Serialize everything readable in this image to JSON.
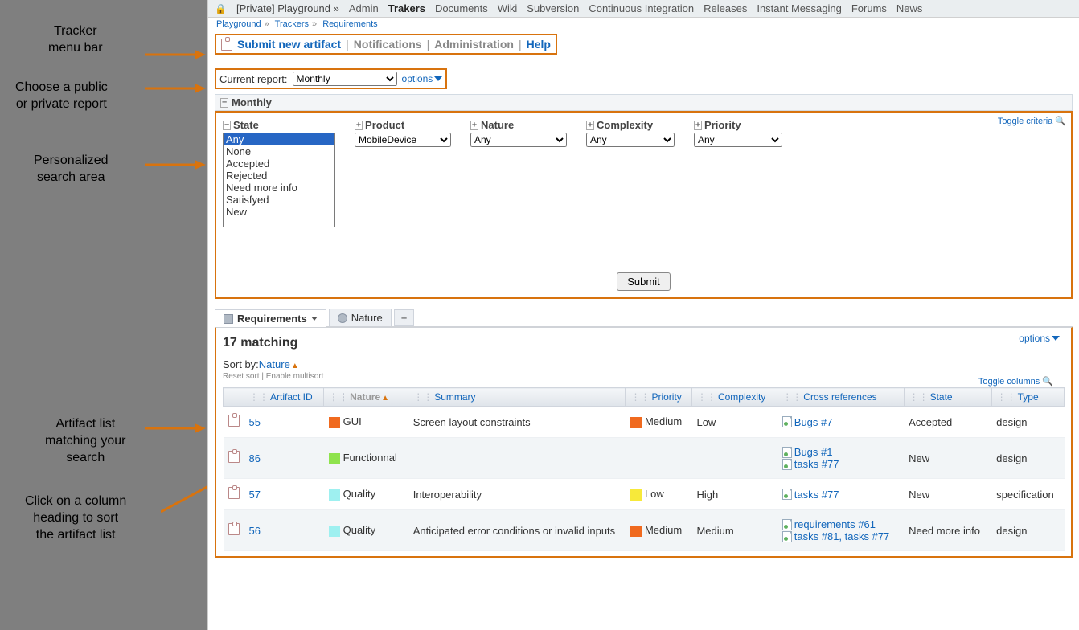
{
  "annotations": {
    "menubar": "Tracker\nmenu bar",
    "report": "Choose a public\nor private report",
    "search": "Personalized\nsearch area",
    "list": "Artifact list\nmatching your\nsearch",
    "sort": "Click on a column\nheading to sort\nthe artifact list"
  },
  "topnav": {
    "project": "[Private] Playground »",
    "items": [
      "Admin",
      "Trakers",
      "Documents",
      "Wiki",
      "Subversion",
      "Continuous Integration",
      "Releases",
      "Instant Messaging",
      "Forums",
      "News"
    ],
    "active": "Trakers"
  },
  "breadcrumb": {
    "a": "Playground",
    "b": "Trackers",
    "c": "Requirements"
  },
  "menubar": {
    "submit": "Submit new artifact",
    "notifications": "Notifications",
    "admin": "Administration",
    "help": "Help"
  },
  "report": {
    "label": "Current report:",
    "value": "Monthly",
    "options": "options"
  },
  "panel": {
    "title": "Monthly",
    "toggle": "Toggle criteria",
    "criteria": {
      "state": {
        "label": "State",
        "opts": [
          "Any",
          "None",
          "Accepted",
          "Rejected",
          "Need more info",
          "Satisfyed",
          "New"
        ],
        "selected": "Any"
      },
      "product": {
        "label": "Product",
        "value": "MobileDevice"
      },
      "nature": {
        "label": "Nature",
        "value": "Any"
      },
      "complexity": {
        "label": "Complexity",
        "value": "Any"
      },
      "priority": {
        "label": "Priority",
        "value": "Any"
      }
    },
    "submit": "Submit"
  },
  "tabs": {
    "a": "Requirements",
    "b": "Nature"
  },
  "results": {
    "options": "options",
    "count": "17 matching",
    "sortby_label": "Sort by:",
    "sortby_field": "Nature",
    "reset": "Reset sort",
    "multisort": "Enable multisort",
    "togglecols": "Toggle columns",
    "headers": {
      "id": "Artifact ID",
      "nature": "Nature",
      "summary": "Summary",
      "priority": "Priority",
      "complexity": "Complexity",
      "xref": "Cross references",
      "state": "State",
      "type": "Type"
    },
    "rows": [
      {
        "id": "55",
        "nature": "GUI",
        "ncolor": "#f06a1f",
        "summary": "Screen layout constraints",
        "priority": "Medium",
        "pcolor": "#f06a1f",
        "complexity": "Low",
        "xrefs": [
          "Bugs #7"
        ],
        "state": "Accepted",
        "type": "design"
      },
      {
        "id": "86",
        "nature": "Functionnal",
        "ncolor": "#8fe34d",
        "summary": "",
        "priority": "",
        "pcolor": "",
        "complexity": "",
        "xrefs": [
          "Bugs #1",
          "tasks #77"
        ],
        "state": "New",
        "type": "design"
      },
      {
        "id": "57",
        "nature": "Quality",
        "ncolor": "#9ef0f0",
        "summary": "Interoperability",
        "priority": "Low",
        "pcolor": "#f7e93a",
        "complexity": "High",
        "xrefs": [
          "tasks #77"
        ],
        "state": "New",
        "type": "specification"
      },
      {
        "id": "56",
        "nature": "Quality",
        "ncolor": "#9ef0f0",
        "summary": "Anticipated error conditions or invalid inputs",
        "priority": "Medium",
        "pcolor": "#f06a1f",
        "complexity": "Medium",
        "xrefs": [
          "requirements #61",
          "tasks #81, tasks #77"
        ],
        "state": "Need more info",
        "type": "design"
      }
    ]
  }
}
